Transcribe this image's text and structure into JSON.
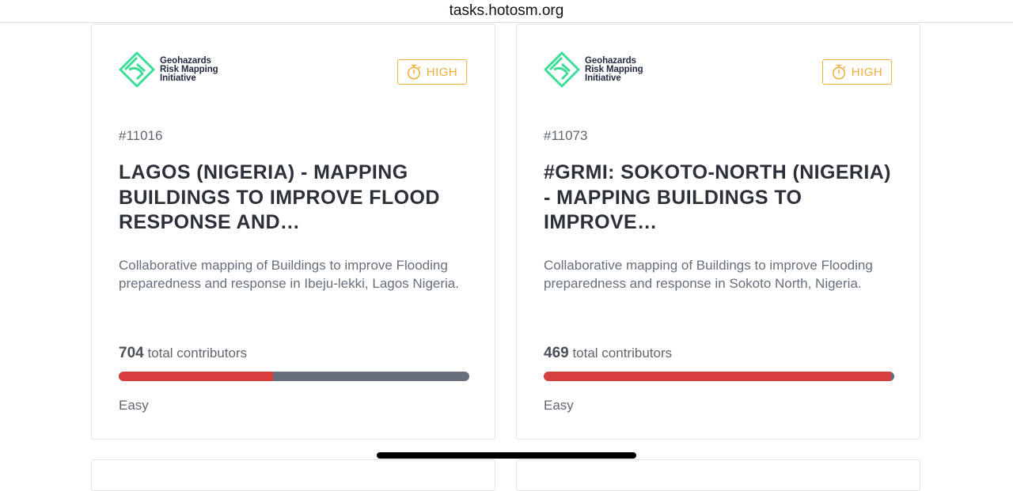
{
  "browser": {
    "url": "tasks.hotosm.org"
  },
  "organisation": {
    "name_line1": "Geohazards",
    "name_line2": "Risk Mapping",
    "name_line3": "Initiative",
    "logo_icon": "diamond-logo-icon",
    "logo_color": "#3ddc97"
  },
  "projects": [
    {
      "id": "#11016",
      "priority": "HIGH",
      "title": "LAGOS (NIGERIA) - MAPPING BUILDINGS TO IMPROVE FLOOD RESPONSE AND…",
      "description": "Collaborative mapping of Buildings to improve Flooding preparedness and response in Ibeju-lekki, Lagos Nigeria.",
      "contributors_count": "704",
      "contributors_label": "total contributors",
      "progress_percent": 44,
      "difficulty": "Easy"
    },
    {
      "id": "#11073",
      "priority": "HIGH",
      "title": "#GRMI: SOKOTO-NORTH (NIGERIA) - MAPPING BUILDINGS TO IMPROVE…",
      "description": "Collaborative mapping of Buildings to improve Flooding preparedness and response in Sokoto North, Nigeria.",
      "contributors_count": "469",
      "contributors_label": "total contributors",
      "progress_percent": 99,
      "difficulty": "Easy"
    }
  ],
  "colors": {
    "priority_high": "#f0ae3a",
    "progress_mapped": "#d73f3f",
    "progress_remaining": "#676f7b"
  }
}
